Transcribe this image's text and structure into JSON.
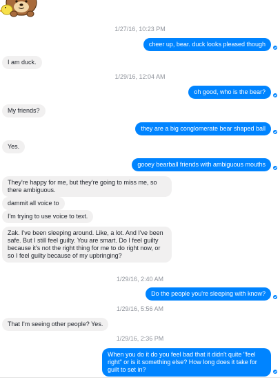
{
  "messages": [
    {
      "kind": "timestamp",
      "text": "1/27/16, 10:23 PM"
    },
    {
      "kind": "sent",
      "text": "cheer up, bear. duck looks pleased though"
    },
    {
      "kind": "received",
      "text": "I am duck."
    },
    {
      "kind": "timestamp",
      "text": "1/29/16, 12:04 AM"
    },
    {
      "kind": "sent",
      "text": "oh good, who is the bear?"
    },
    {
      "kind": "received",
      "text": "My friends?"
    },
    {
      "kind": "sent",
      "text": "they are a big conglomerate bear shaped ball"
    },
    {
      "kind": "received",
      "text": "Yes."
    },
    {
      "kind": "sent",
      "text": "gooey bearball friends with ambiguous mouths"
    },
    {
      "kind": "received",
      "text": "They're happy for me, but they're going to miss me, so there ambiguous."
    },
    {
      "kind": "received",
      "text": "dammit all voice to"
    },
    {
      "kind": "received",
      "text": "I'm trying to use voice to text."
    },
    {
      "kind": "received",
      "text": "Zak. I've been sleeping around. Like, a lot. And I've been safe. But I still feel guilty. You are smart. Do I feel guilty because it's not the right thing for me to do right now, or so I feel guilty because of my upbringing?"
    },
    {
      "kind": "timestamp",
      "text": "1/29/16, 2:40 AM"
    },
    {
      "kind": "sent",
      "text": "Do the people you're sleeping with know?"
    },
    {
      "kind": "timestamp",
      "text": "1/29/16, 5:56 AM"
    },
    {
      "kind": "received",
      "text": "That I'm seeing other people? Yes."
    },
    {
      "kind": "timestamp",
      "text": "1/29/16, 2:36 PM"
    },
    {
      "kind": "sent",
      "text": "When you do it do you feel bad that it didn't quite \"feel right\" or is it something else? How long does it take for guilt to set in?"
    }
  ],
  "colors": {
    "sent_bubble": "#0084ff",
    "received_bubble": "#f1f0f0",
    "timestamp_text": "#90949c"
  }
}
